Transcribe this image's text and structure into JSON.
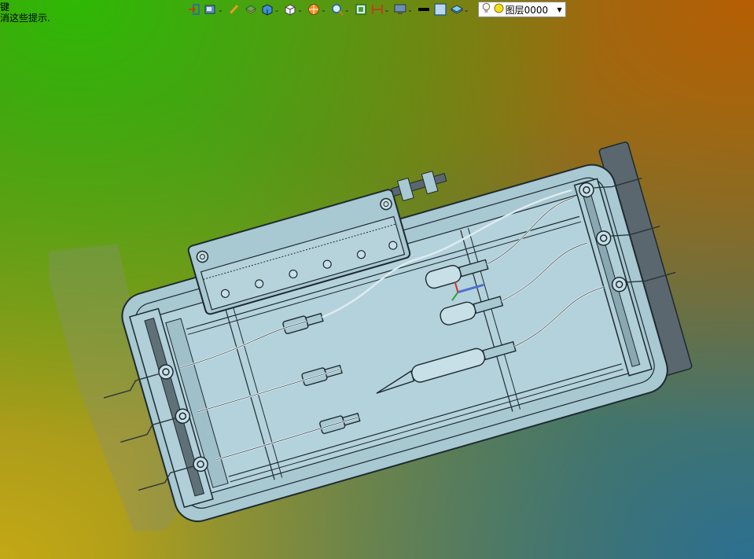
{
  "hint": {
    "line1": "键",
    "line2": "消这些提示."
  },
  "toolbar": {
    "icons": [
      "exit-icon",
      "view-orientation-icon",
      "sketch-icon",
      "display-style-icon",
      "section-view-icon",
      "view-cube-icon",
      "appearance-icon",
      "zoom-icon",
      "fit-icon",
      "dimension-icon",
      "monitor-icon",
      "line-color-icon",
      "fill-color-icon",
      "layer-icon"
    ],
    "layer_name": "图层0000"
  },
  "colors": {
    "part_fill": "#a8c8d2",
    "part_dark": "#7e9aa4",
    "edge": "#1e2a30",
    "gasket": "#566268",
    "triad_red": "#d23030",
    "triad_green": "#30a030",
    "triad_blue": "#5070d0"
  }
}
